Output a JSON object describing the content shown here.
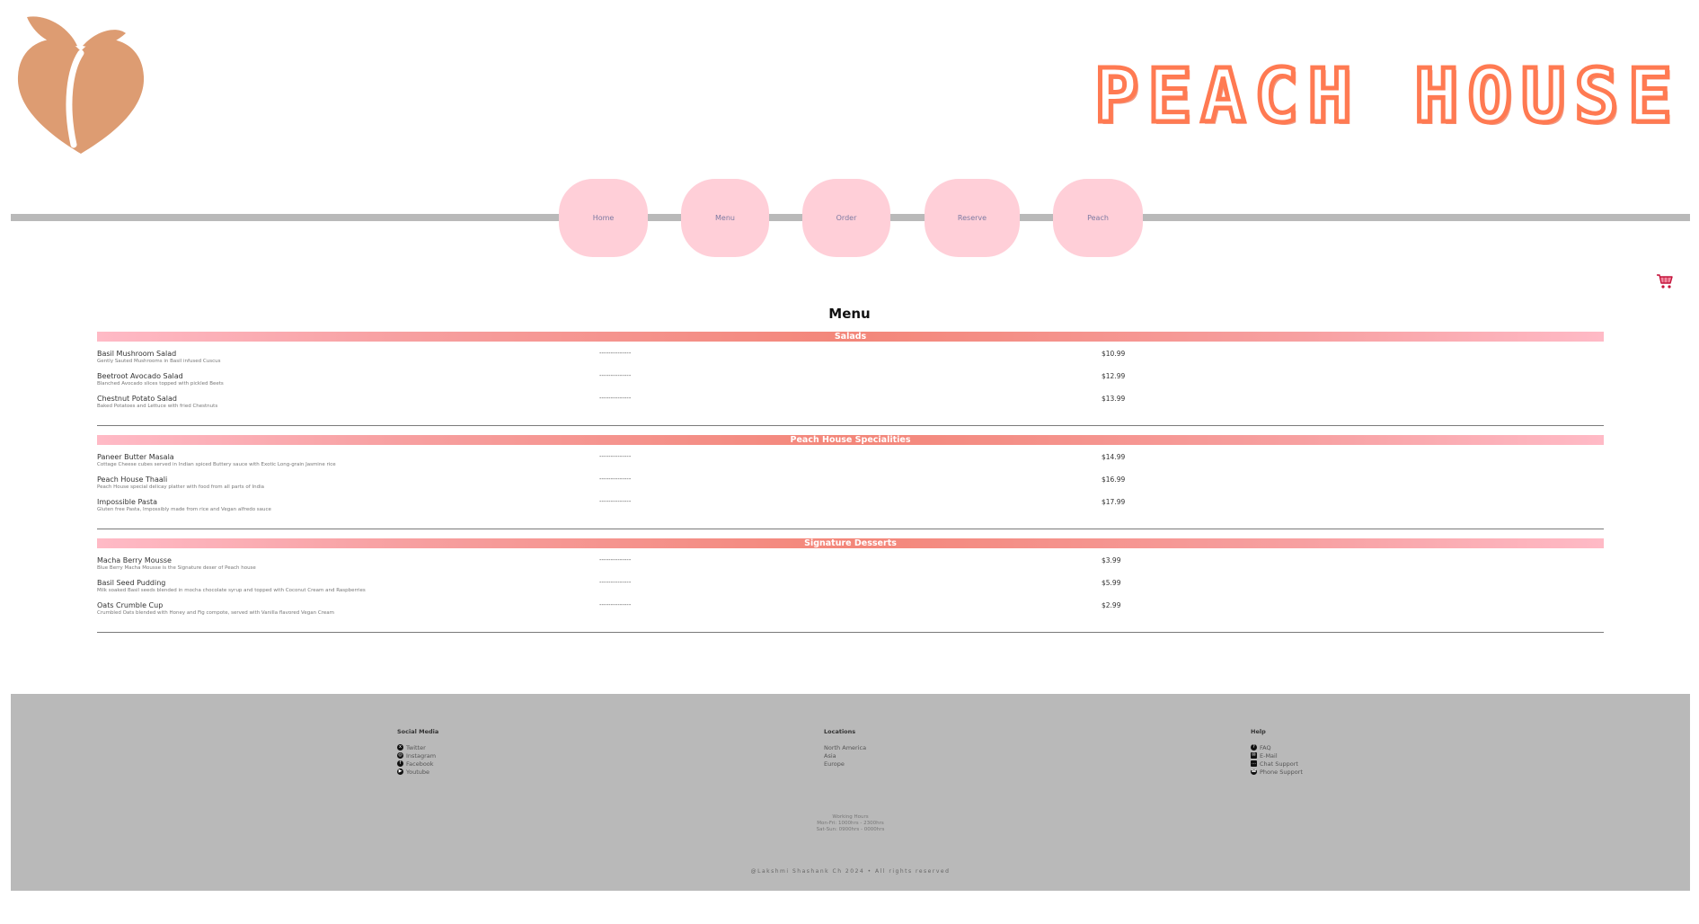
{
  "brand": {
    "title": "PEACH HOUSE",
    "colors": {
      "accent": "#ff7a52",
      "peach": "#dd9c72",
      "nav_pill": "#ffcfd8"
    },
    "logo_icon": "peach-icon"
  },
  "nav": {
    "items": [
      {
        "label": "Home"
      },
      {
        "label": "Menu"
      },
      {
        "label": "Order"
      },
      {
        "label": "Reserve"
      },
      {
        "label": "Peach"
      }
    ],
    "cart_icon": "shopping-cart-icon"
  },
  "menu": {
    "title": "Menu",
    "categories": [
      {
        "name": "Salads",
        "items": [
          {
            "name": "Basil Mushroom Salad",
            "desc": "Gently Sauted Mushrooms in Basil infused Cuscus",
            "dots": "--------------",
            "price": "$10.99"
          },
          {
            "name": "Beetroot Avocado Salad",
            "desc": "Blanched Avocado slices topped with pickled Beets",
            "dots": "--------------",
            "price": "$12.99"
          },
          {
            "name": "Chestnut Potato Salad",
            "desc": "Baked Potatoes and Lettuce with fried Chestnuts",
            "dots": "--------------",
            "price": "$13.99"
          }
        ]
      },
      {
        "name": "Peach House Specialities",
        "items": [
          {
            "name": "Paneer Butter Masala",
            "desc": "Cottage Cheese cubes served in Indian spiced Buttery sauce with Exotic Long-grain Jasmine rice",
            "dots": "--------------",
            "price": "$14.99"
          },
          {
            "name": "Peach House Thaali",
            "desc": "Peach House special delicay platter with food from all parts of India",
            "dots": "--------------",
            "price": "$16.99"
          },
          {
            "name": "Impossible Pasta",
            "desc": "Gluten free Pasta, Impossibly made from rice and Vegan alfredo sauce",
            "dots": "--------------",
            "price": "$17.99"
          }
        ]
      },
      {
        "name": "Signature Desserts",
        "items": [
          {
            "name": "Macha Berry Mousse",
            "desc": "Blue Berry Macha Mousse is the Signature deser of Peach house",
            "dots": "--------------",
            "price": "$3.99"
          },
          {
            "name": "Basil Seed Pudding",
            "desc": "Milk soaked Basil seeds blended in mocha chocolate syrup and topped with Coconut Cream and Raspberries",
            "dots": "--------------",
            "price": "$5.99"
          },
          {
            "name": "Oats Crumble Cup",
            "desc": "Crumbled Oats blended with Honey and Fig compote, served with Vanilla flavored Vegan Cream",
            "dots": "--------------",
            "price": "$2.99"
          }
        ]
      }
    ]
  },
  "footer": {
    "social": {
      "heading": "Social Media",
      "links": [
        {
          "label": "Twitter",
          "icon": "twitter-icon"
        },
        {
          "label": "Instagram",
          "icon": "instagram-icon"
        },
        {
          "label": "Facebook",
          "icon": "facebook-icon"
        },
        {
          "label": "Youtube",
          "icon": "youtube-icon"
        }
      ]
    },
    "locations": {
      "heading": "Locations",
      "links": [
        {
          "label": "North America"
        },
        {
          "label": "Asia"
        },
        {
          "label": "Europe"
        }
      ]
    },
    "help": {
      "heading": "Help",
      "links": [
        {
          "label": "FAQ",
          "icon": "question-icon"
        },
        {
          "label": "E-Mail",
          "icon": "mail-icon"
        },
        {
          "label": "Chat Support",
          "icon": "chat-icon"
        },
        {
          "label": "Phone Support",
          "icon": "phone-icon"
        }
      ]
    },
    "hours": {
      "title": "Working Hours",
      "weekdays": "Mon-Fri: 1000hrs - 2300hrs",
      "weekend": "Sat-Sun: 0900hrs - 0000hrs"
    },
    "copyright": "@Lakshmi Shashank Ch 2024 • All rights reserved"
  }
}
